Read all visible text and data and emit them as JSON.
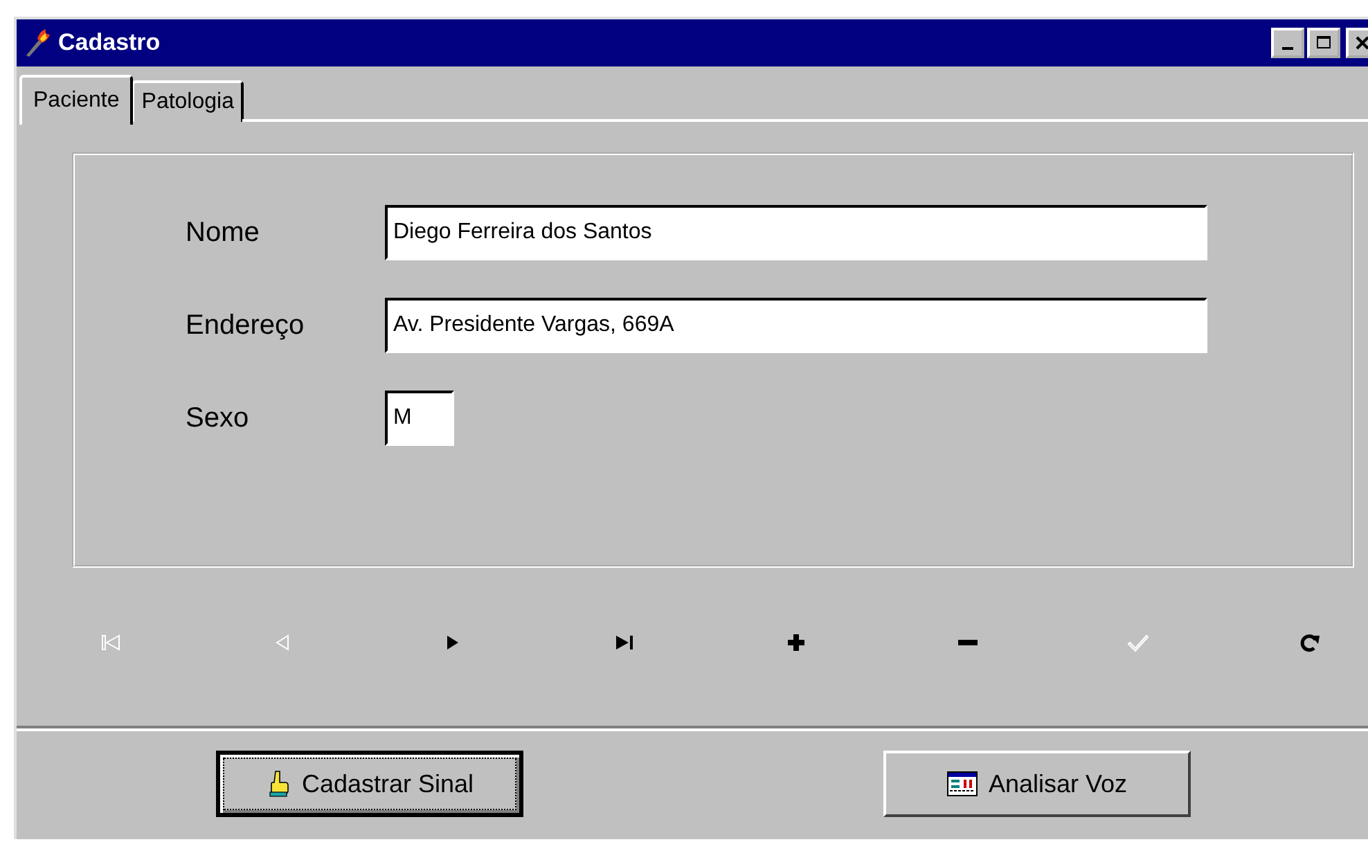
{
  "window": {
    "title": "Cadastro"
  },
  "tabs": [
    {
      "label": "Paciente",
      "selected": true
    },
    {
      "label": "Patologia",
      "selected": false
    }
  ],
  "fields": [
    {
      "label": "Nome",
      "value": "Diego Ferreira dos Santos",
      "kind": "long"
    },
    {
      "label": "Endereço",
      "value": "Av. Presidente Vargas, 669A",
      "kind": "long"
    },
    {
      "label": "Sexo",
      "value": "M",
      "kind": "short"
    }
  ],
  "navigator": [
    {
      "kind": "first",
      "disabled": true
    },
    {
      "kind": "prior",
      "disabled": true
    },
    {
      "kind": "next",
      "disabled": false
    },
    {
      "kind": "last",
      "disabled": false
    },
    {
      "kind": "insert",
      "disabled": false
    },
    {
      "kind": "delete",
      "disabled": false
    },
    {
      "kind": "post",
      "disabled": true
    },
    {
      "kind": "refresh",
      "disabled": false
    }
  ],
  "buttons": [
    {
      "label": "Cadastrar Sinal",
      "kind": "hand",
      "focused": true
    },
    {
      "label": "Analisar Voz",
      "kind": "chart",
      "focused": false
    }
  ]
}
